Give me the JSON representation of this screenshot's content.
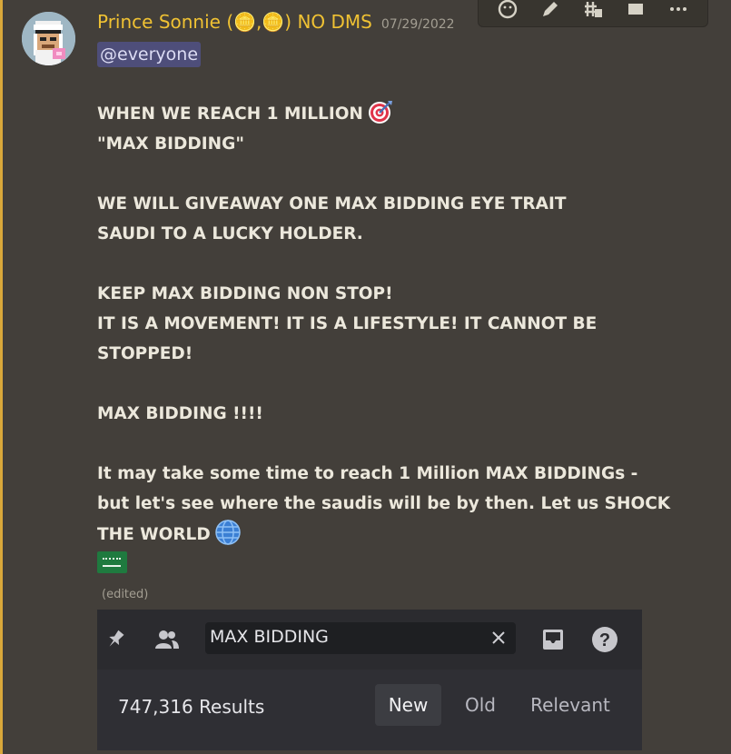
{
  "message": {
    "username": "Prince Sonnie (🪙,🪙) NO DMS",
    "timestamp": "07/29/2022",
    "mention": "@everyone",
    "lines": [
      "WHEN WE REACH 1 MILLION",
      "\"MAX BIDDING\"",
      "",
      "WE WILL GIVEAWAY ONE MAX BIDDING EYE TRAIT",
      "SAUDI TO A LUCKY HOLDER.",
      "",
      "KEEP MAX BIDDING NON STOP!",
      "IT IS A MOVEMENT! IT IS A LIFESTYLE! IT CANNOT BE",
      "STOPPED!",
      "",
      "MAX BIDDING !!!!",
      "",
      "It may take some time to reach 1 Million MAX BIDDINGs -",
      "but let's see where the saudis will be by then. Let us SHOCK",
      "THE WORLD"
    ],
    "edited_label": "(edited)",
    "emojis": [
      "target-emoji",
      "globe-emoji",
      "saudi-flag-emoji"
    ]
  },
  "hover_toolbar": {
    "icons": [
      "add-reaction-icon",
      "edit-icon",
      "create-thread-icon",
      "forward-icon",
      "more-icon"
    ]
  },
  "embed": {
    "search_value": "MAX BIDDING",
    "results_count": "747,316 Results",
    "tabs": [
      {
        "label": "New",
        "active": true
      },
      {
        "label": "Old",
        "active": false
      },
      {
        "label": "Relevant",
        "active": false
      }
    ],
    "icons": [
      "pin-icon",
      "members-icon",
      "clear-icon",
      "inbox-icon",
      "help-icon"
    ]
  },
  "colors": {
    "background": "#433f3a",
    "username": "#f0c233",
    "mention_bg": "#4e4e7a",
    "accent_bar": "#d9a83a"
  }
}
